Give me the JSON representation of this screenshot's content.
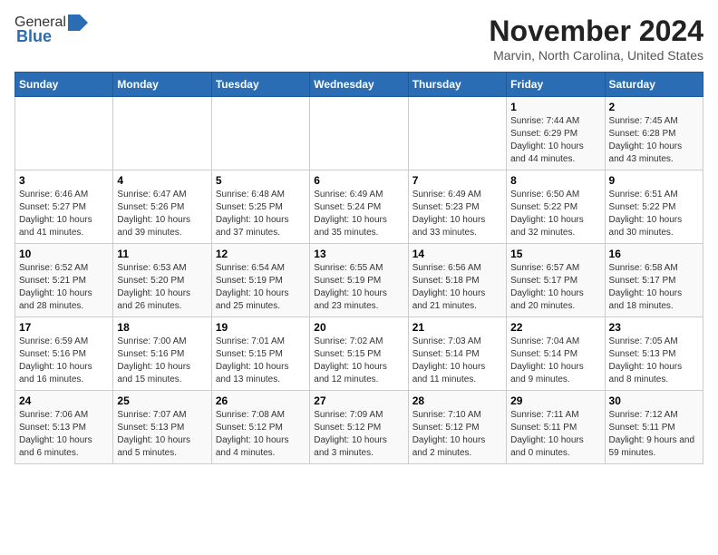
{
  "logo": {
    "general": "General",
    "blue": "Blue"
  },
  "title": "November 2024",
  "location": "Marvin, North Carolina, United States",
  "days_of_week": [
    "Sunday",
    "Monday",
    "Tuesday",
    "Wednesday",
    "Thursday",
    "Friday",
    "Saturday"
  ],
  "weeks": [
    [
      {
        "day": "",
        "info": ""
      },
      {
        "day": "",
        "info": ""
      },
      {
        "day": "",
        "info": ""
      },
      {
        "day": "",
        "info": ""
      },
      {
        "day": "",
        "info": ""
      },
      {
        "day": "1",
        "info": "Sunrise: 7:44 AM\nSunset: 6:29 PM\nDaylight: 10 hours and 44 minutes."
      },
      {
        "day": "2",
        "info": "Sunrise: 7:45 AM\nSunset: 6:28 PM\nDaylight: 10 hours and 43 minutes."
      }
    ],
    [
      {
        "day": "3",
        "info": "Sunrise: 6:46 AM\nSunset: 5:27 PM\nDaylight: 10 hours and 41 minutes."
      },
      {
        "day": "4",
        "info": "Sunrise: 6:47 AM\nSunset: 5:26 PM\nDaylight: 10 hours and 39 minutes."
      },
      {
        "day": "5",
        "info": "Sunrise: 6:48 AM\nSunset: 5:25 PM\nDaylight: 10 hours and 37 minutes."
      },
      {
        "day": "6",
        "info": "Sunrise: 6:49 AM\nSunset: 5:24 PM\nDaylight: 10 hours and 35 minutes."
      },
      {
        "day": "7",
        "info": "Sunrise: 6:49 AM\nSunset: 5:23 PM\nDaylight: 10 hours and 33 minutes."
      },
      {
        "day": "8",
        "info": "Sunrise: 6:50 AM\nSunset: 5:22 PM\nDaylight: 10 hours and 32 minutes."
      },
      {
        "day": "9",
        "info": "Sunrise: 6:51 AM\nSunset: 5:22 PM\nDaylight: 10 hours and 30 minutes."
      }
    ],
    [
      {
        "day": "10",
        "info": "Sunrise: 6:52 AM\nSunset: 5:21 PM\nDaylight: 10 hours and 28 minutes."
      },
      {
        "day": "11",
        "info": "Sunrise: 6:53 AM\nSunset: 5:20 PM\nDaylight: 10 hours and 26 minutes."
      },
      {
        "day": "12",
        "info": "Sunrise: 6:54 AM\nSunset: 5:19 PM\nDaylight: 10 hours and 25 minutes."
      },
      {
        "day": "13",
        "info": "Sunrise: 6:55 AM\nSunset: 5:19 PM\nDaylight: 10 hours and 23 minutes."
      },
      {
        "day": "14",
        "info": "Sunrise: 6:56 AM\nSunset: 5:18 PM\nDaylight: 10 hours and 21 minutes."
      },
      {
        "day": "15",
        "info": "Sunrise: 6:57 AM\nSunset: 5:17 PM\nDaylight: 10 hours and 20 minutes."
      },
      {
        "day": "16",
        "info": "Sunrise: 6:58 AM\nSunset: 5:17 PM\nDaylight: 10 hours and 18 minutes."
      }
    ],
    [
      {
        "day": "17",
        "info": "Sunrise: 6:59 AM\nSunset: 5:16 PM\nDaylight: 10 hours and 16 minutes."
      },
      {
        "day": "18",
        "info": "Sunrise: 7:00 AM\nSunset: 5:16 PM\nDaylight: 10 hours and 15 minutes."
      },
      {
        "day": "19",
        "info": "Sunrise: 7:01 AM\nSunset: 5:15 PM\nDaylight: 10 hours and 13 minutes."
      },
      {
        "day": "20",
        "info": "Sunrise: 7:02 AM\nSunset: 5:15 PM\nDaylight: 10 hours and 12 minutes."
      },
      {
        "day": "21",
        "info": "Sunrise: 7:03 AM\nSunset: 5:14 PM\nDaylight: 10 hours and 11 minutes."
      },
      {
        "day": "22",
        "info": "Sunrise: 7:04 AM\nSunset: 5:14 PM\nDaylight: 10 hours and 9 minutes."
      },
      {
        "day": "23",
        "info": "Sunrise: 7:05 AM\nSunset: 5:13 PM\nDaylight: 10 hours and 8 minutes."
      }
    ],
    [
      {
        "day": "24",
        "info": "Sunrise: 7:06 AM\nSunset: 5:13 PM\nDaylight: 10 hours and 6 minutes."
      },
      {
        "day": "25",
        "info": "Sunrise: 7:07 AM\nSunset: 5:13 PM\nDaylight: 10 hours and 5 minutes."
      },
      {
        "day": "26",
        "info": "Sunrise: 7:08 AM\nSunset: 5:12 PM\nDaylight: 10 hours and 4 minutes."
      },
      {
        "day": "27",
        "info": "Sunrise: 7:09 AM\nSunset: 5:12 PM\nDaylight: 10 hours and 3 minutes."
      },
      {
        "day": "28",
        "info": "Sunrise: 7:10 AM\nSunset: 5:12 PM\nDaylight: 10 hours and 2 minutes."
      },
      {
        "day": "29",
        "info": "Sunrise: 7:11 AM\nSunset: 5:11 PM\nDaylight: 10 hours and 0 minutes."
      },
      {
        "day": "30",
        "info": "Sunrise: 7:12 AM\nSunset: 5:11 PM\nDaylight: 9 hours and 59 minutes."
      }
    ]
  ]
}
